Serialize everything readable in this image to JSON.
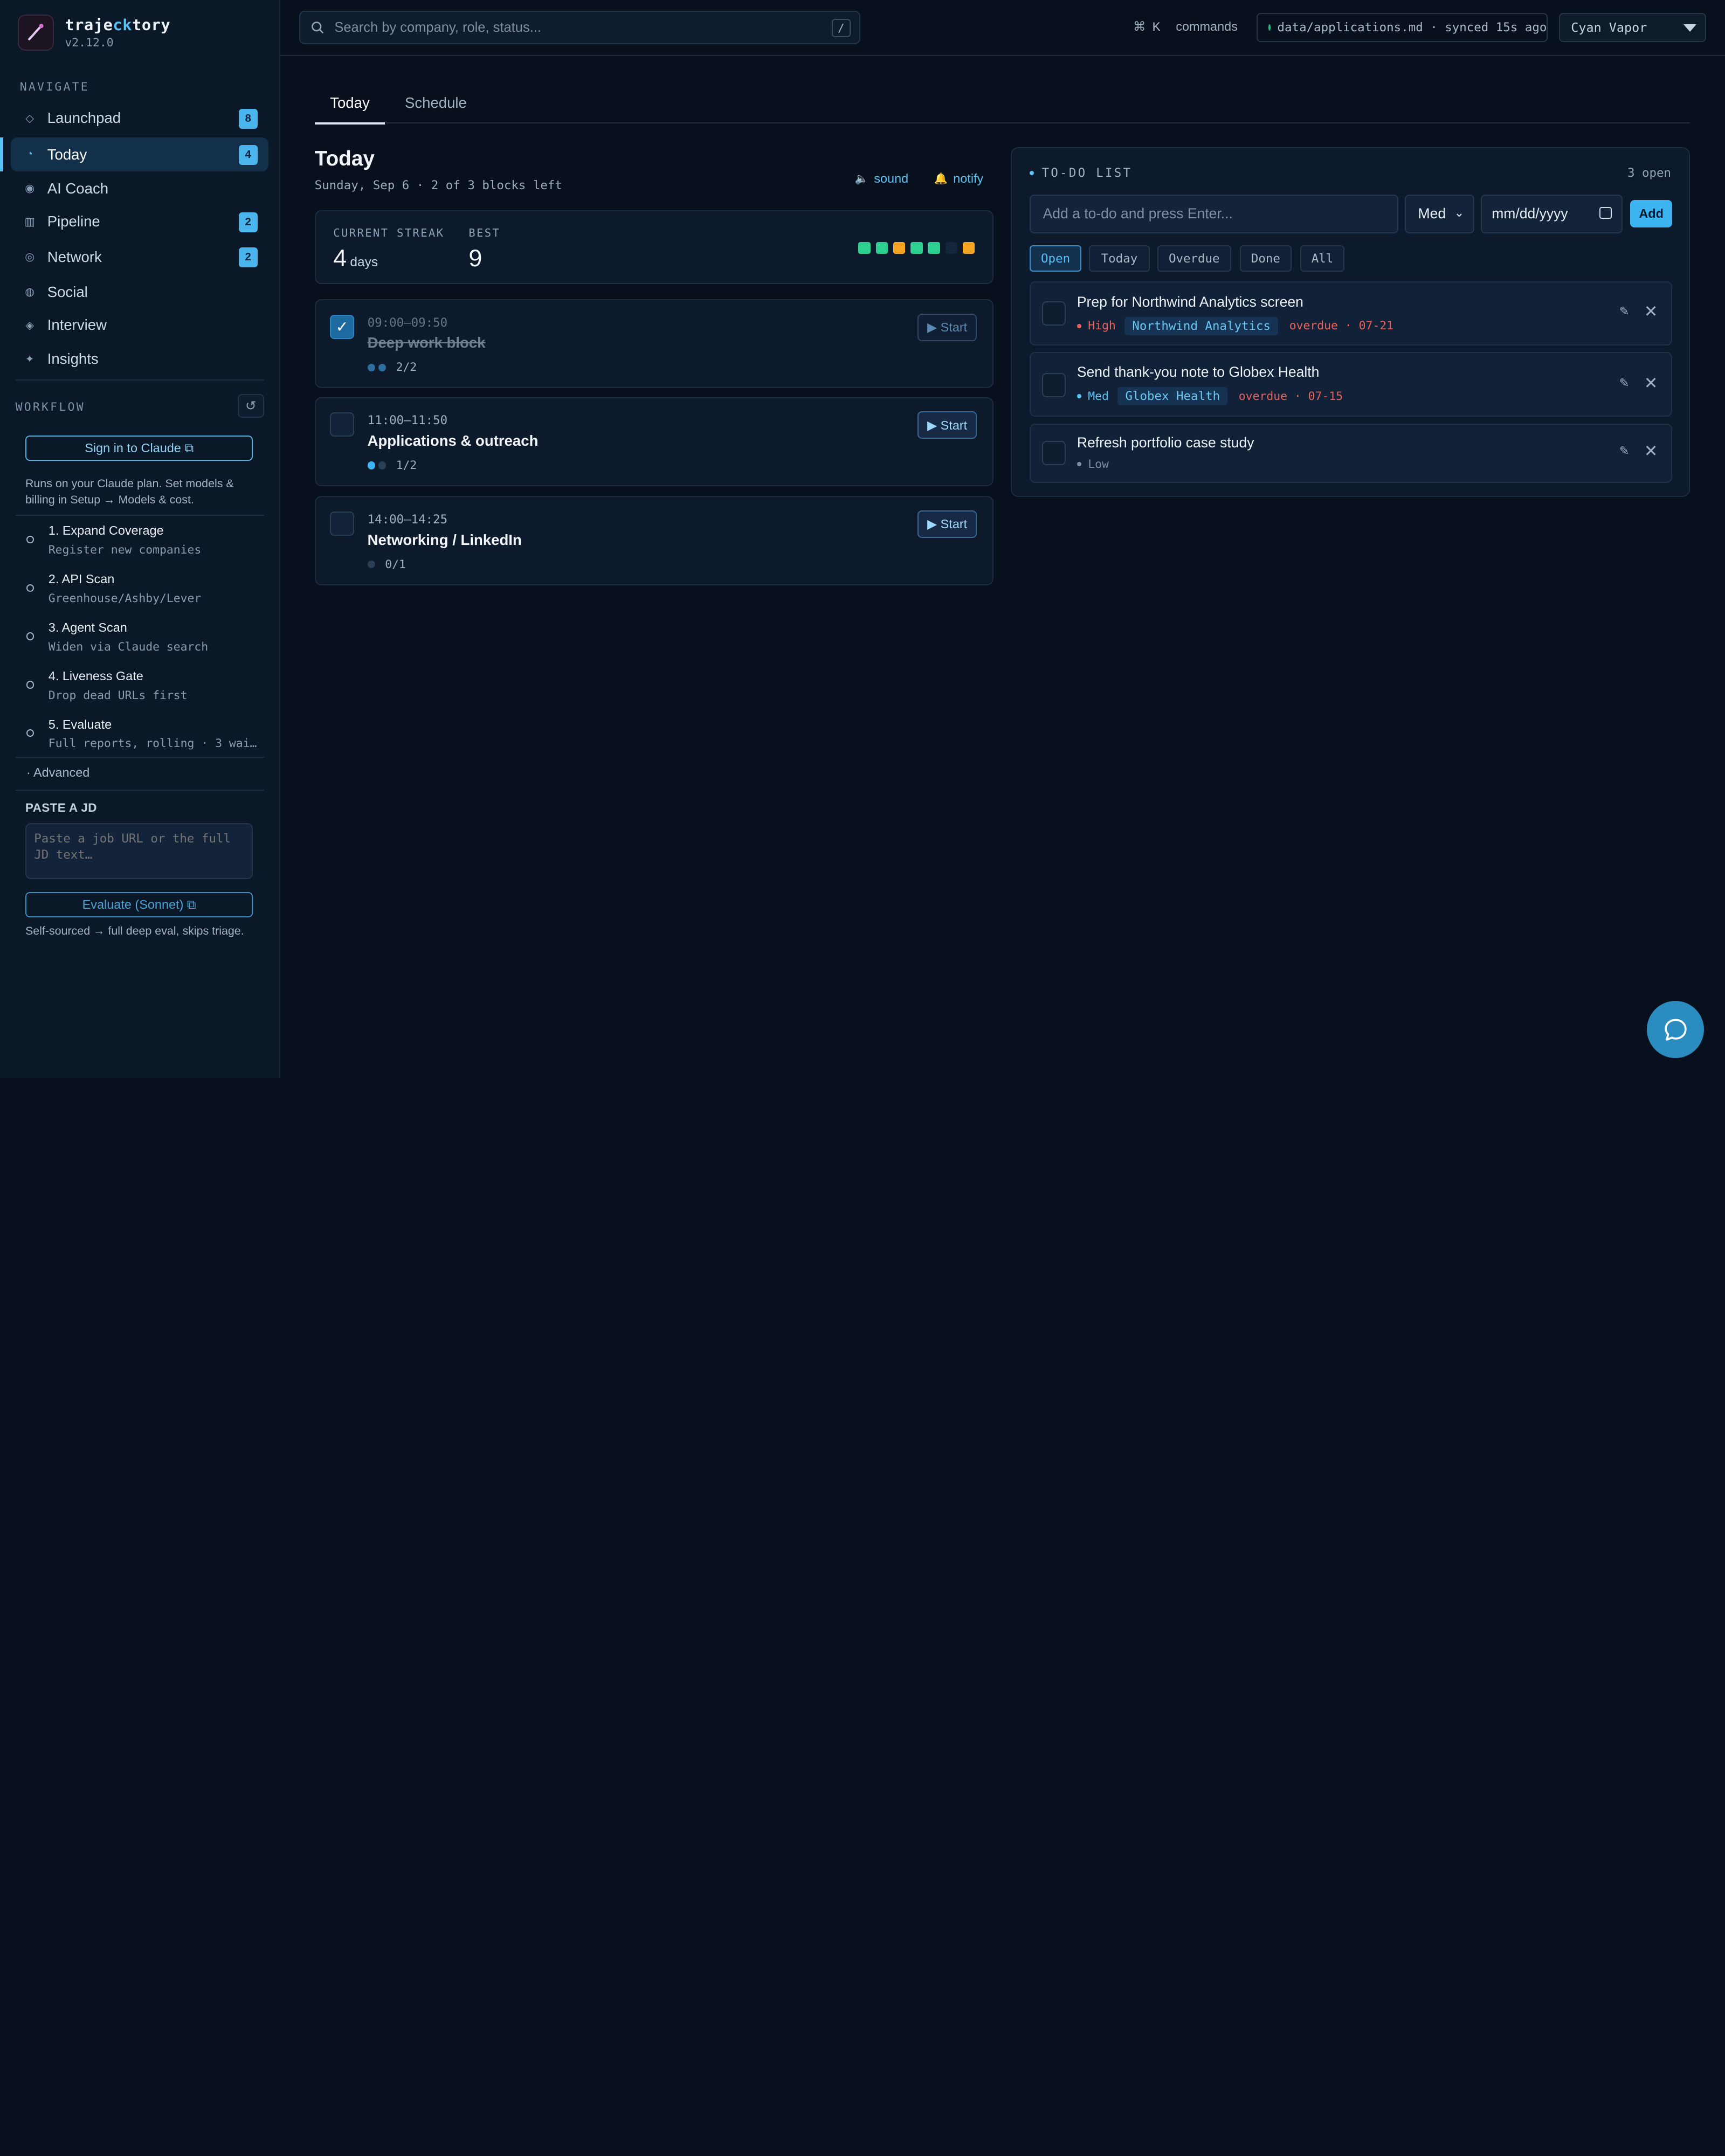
{
  "brand": {
    "name_pre": "traje",
    "name_hl": "ck",
    "name_post": "tory",
    "version": "v2.12.0"
  },
  "nav": {
    "section_label": "NAVIGATE",
    "items": [
      {
        "label": "Launchpad",
        "glyph": "◇",
        "badge": "8"
      },
      {
        "label": "Today",
        "glyph": "◔",
        "badge": "4",
        "active": true
      },
      {
        "label": "AI Coach",
        "glyph": "◉",
        "badge": ""
      },
      {
        "label": "Pipeline",
        "glyph": "▥",
        "badge": "2"
      },
      {
        "label": "Network",
        "glyph": "◎",
        "badge": "2"
      },
      {
        "label": "Social",
        "glyph": "◍",
        "badge": ""
      },
      {
        "label": "Interview",
        "glyph": "◈",
        "badge": ""
      },
      {
        "label": "Insights",
        "glyph": "✦",
        "badge": ""
      }
    ]
  },
  "workflow": {
    "label": "WORKFLOW",
    "refresh_icon": "↺",
    "signin_label": "Sign in to Claude ⧉",
    "note": "Runs on your Claude plan. Set models & billing in Setup → Models & cost.",
    "steps": [
      {
        "title": "1. Expand Coverage",
        "sub": "Register new companies"
      },
      {
        "title": "2. API Scan",
        "sub": "Greenhouse/Ashby/Lever"
      },
      {
        "title": "3. Agent Scan",
        "sub": "Widen via Claude search"
      },
      {
        "title": "4. Liveness Gate",
        "sub": "Drop dead URLs first"
      },
      {
        "title": "5. Evaluate",
        "sub": "Full reports, rolling · 3 wai…"
      }
    ],
    "advanced": "· Advanced",
    "jd_label": "PASTE A JD",
    "jd_placeholder": "Paste a job URL or the full JD text…",
    "evaluate_label": "Evaluate (Sonnet) ⧉",
    "evaluate_note": "Self-sourced → full deep eval, skips triage."
  },
  "topbar": {
    "search_placeholder": "Search by company, role, status...",
    "search_kbd": "/",
    "cmd_symbol": "⌘",
    "cmd_key": "K",
    "cmd_label": "commands",
    "sync_text": "data/applications.md · synced 15s ago",
    "theme": "Cyan Vapor"
  },
  "tabs": [
    {
      "label": "Today",
      "active": true
    },
    {
      "label": "Schedule"
    }
  ],
  "today": {
    "title": "Today",
    "subtitle": "Sunday, Sep 6 · 2 of 3 blocks left",
    "sound_label": "sound",
    "notify_label": "notify",
    "streak": {
      "current_label": "CURRENT STREAK",
      "current_value": "4",
      "current_unit": "days",
      "best_label": "BEST",
      "best_value": "9",
      "days": [
        "#2fd193",
        "#2fd193",
        "#f6a623",
        "#2fd193",
        "#2fd193",
        "#14263a",
        "#f6a623"
      ]
    },
    "blocks": [
      {
        "time": "09:00–09:50",
        "title": "Deep work block",
        "done": true,
        "progress": "2/2",
        "dots": [
          1,
          1
        ],
        "start": "▶ Start"
      },
      {
        "time": "11:00–11:50",
        "title": "Applications & outreach",
        "done": false,
        "progress": "1/2",
        "dots": [
          1,
          0
        ],
        "start": "▶ Start"
      },
      {
        "time": "14:00–14:25",
        "title": "Networking / LinkedIn",
        "done": false,
        "progress": "0/1",
        "dots": [
          0
        ],
        "start": "▶ Start"
      }
    ]
  },
  "todo": {
    "title": "TO-DO LIST",
    "count": "3 open",
    "input_placeholder": "Add a to-do and press Enter...",
    "priority_value": "Med",
    "date_placeholder": "mm/dd/yyyy",
    "add_label": "Add",
    "filters": [
      "Open",
      "Today",
      "Overdue",
      "Done",
      "All"
    ],
    "items": [
      {
        "title": "Prep for Northwind Analytics screen",
        "priority": "High",
        "priority_color": "#e8625c",
        "tag": "Northwind Analytics",
        "overdue": "overdue · 07-21"
      },
      {
        "title": "Send thank-you note to Globex Health",
        "priority": "Med",
        "priority_color": "#58c3f4",
        "tag": "Globex Health",
        "overdue": "overdue · 07-15"
      },
      {
        "title": "Refresh portfolio case study",
        "priority": "Low",
        "priority_color": "#7e8fa3",
        "tag": "",
        "overdue": ""
      }
    ]
  },
  "colors": {
    "accent": "#58c3f4",
    "success": "#2fd193",
    "warn": "#f6a623",
    "danger": "#e8625c"
  }
}
